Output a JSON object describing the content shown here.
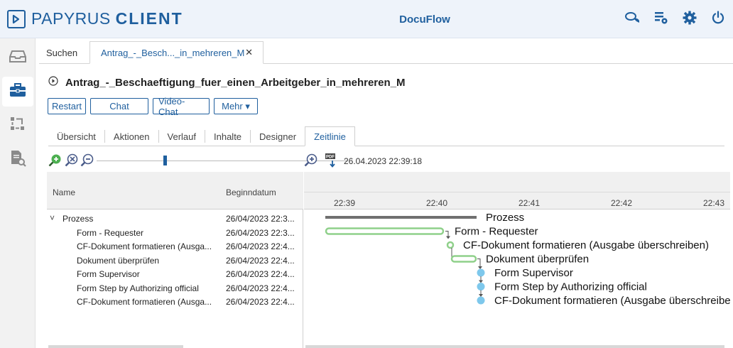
{
  "header": {
    "logo_icon": "arrow-in-box-icon",
    "logo_text_plain": "PAPYRUS ",
    "logo_text_bold": "CLIENT",
    "app_title": "DocuFlow",
    "icons": [
      "chat-bubbles-icon",
      "task-settings-icon",
      "gear-icon",
      "power-icon"
    ]
  },
  "sidebar": {
    "items": [
      {
        "icon": "inbox-tray-icon",
        "active": false
      },
      {
        "icon": "briefcase-icon",
        "active": true
      },
      {
        "icon": "workflow-icon",
        "active": false
      },
      {
        "icon": "document-search-icon",
        "active": false
      }
    ]
  },
  "tabs": {
    "search": "Suchen",
    "active_doc": "Antrag_-_Besch..._in_mehreren_M",
    "close": "✕"
  },
  "document": {
    "title": "Antrag_-_Beschaeftigung_fuer_einen_Arbeitgeber_in_mehreren_M",
    "buttons": {
      "restart": "Restart",
      "chat": "Chat",
      "video_chat": "Video-Chat",
      "more": "Mehr ▾"
    }
  },
  "subtabs": [
    "Übersicht",
    "Aktionen",
    "Verlauf",
    "Inhalte",
    "Designer",
    "Zeitlinie"
  ],
  "active_subtab": "Zeitlinie",
  "timeline": {
    "timestamp": "26.04.2023 22:39:18",
    "slider_level": 0.27,
    "columns": {
      "name": "Name",
      "start": "Beginndatum"
    },
    "time_labels": [
      "22:39",
      "22:40",
      "22:41",
      "22:42",
      "22:43"
    ],
    "rows": [
      {
        "name": "Prozess",
        "start": "26/04/2023 22:3...",
        "bar_label": "Prozess",
        "expander": "˅"
      },
      {
        "name": "Form - Requester",
        "start": "26/04/2023 22:3...",
        "bar_label": "Form - Requester"
      },
      {
        "name": "CF-Dokument formatieren (Ausga...",
        "start": "26/04/2023 22:4...",
        "bar_label": "CF-Dokument formatieren (Ausgabe überschreiben)"
      },
      {
        "name": "Dokument überprüfen",
        "start": "26/04/2023 22:4...",
        "bar_label": "Dokument überprüfen"
      },
      {
        "name": "Form  Supervisor",
        "start": "26/04/2023 22:4...",
        "bar_label": "Form  Supervisor"
      },
      {
        "name": "Form Step by Authorizing official",
        "start": "26/04/2023 22:4...",
        "bar_label": "Form Step by Authorizing official"
      },
      {
        "name": "CF-Dokument formatieren (Ausga...",
        "start": "26/04/2023 22:4...",
        "bar_label": "CF-Dokument formatieren (Ausgabe überschreiben)"
      }
    ]
  },
  "colors": {
    "brand": "#1f5f9e",
    "summary_bar": "#707070",
    "task_bar": "#8fd08a",
    "milestone": "#7ec8ec",
    "connector": "#555555"
  }
}
